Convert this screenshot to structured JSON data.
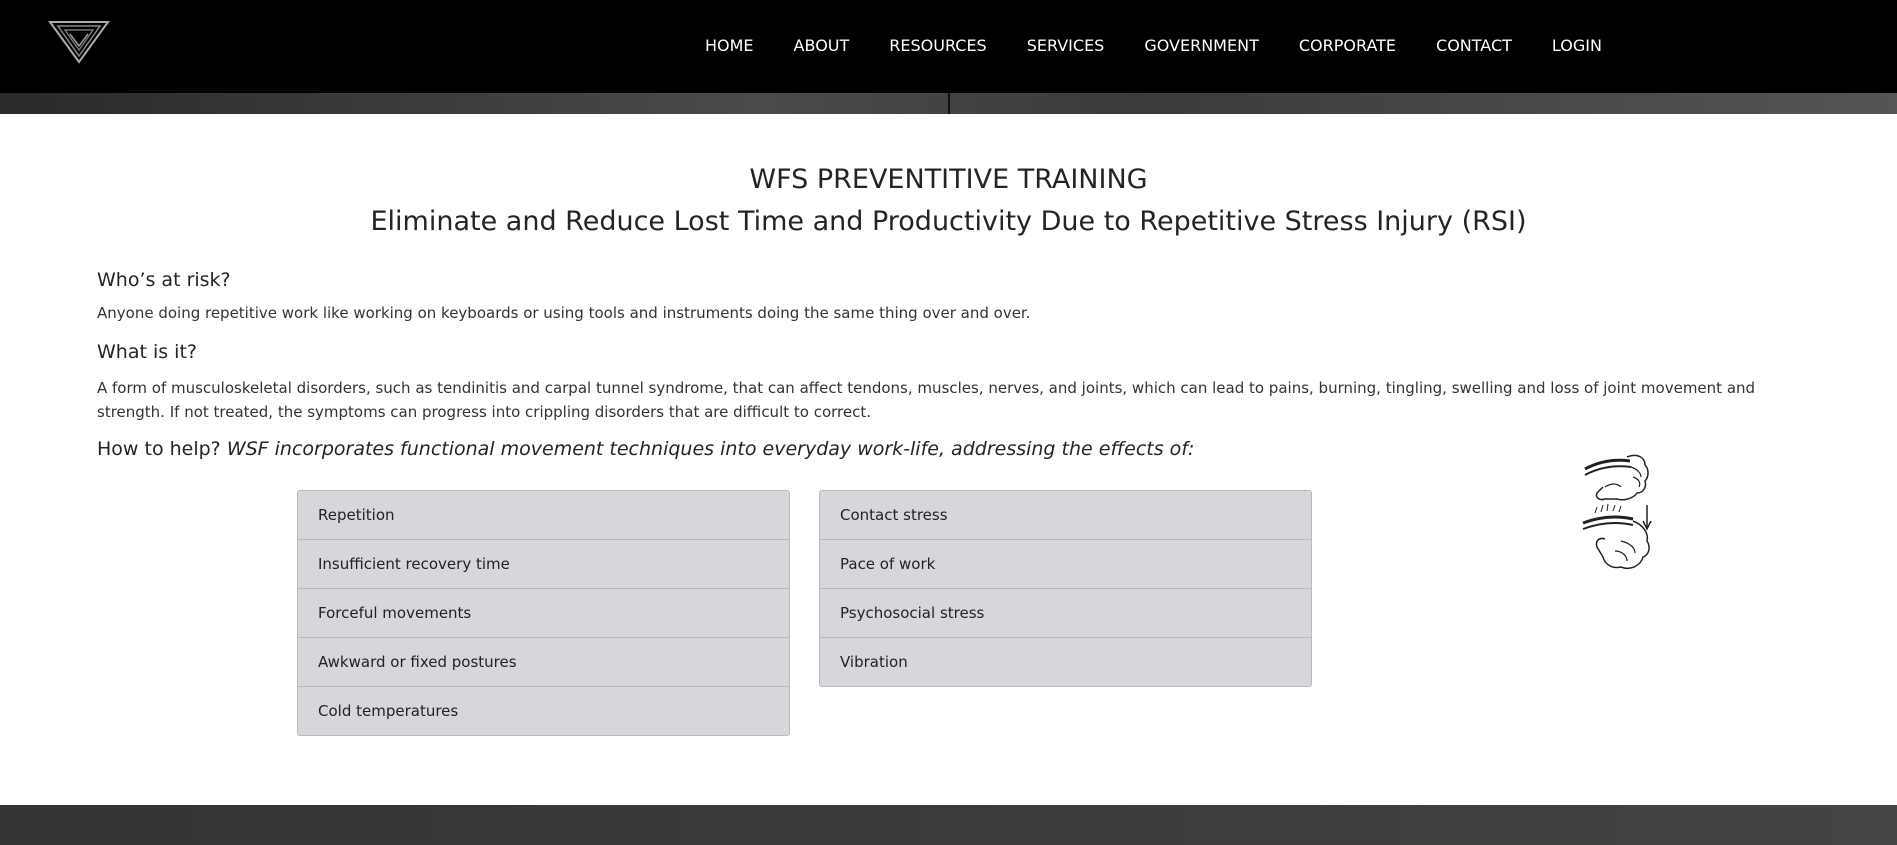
{
  "nav": {
    "items": [
      {
        "label": "HOME"
      },
      {
        "label": "ABOUT"
      },
      {
        "label": "RESOURCES"
      },
      {
        "label": "SERVICES"
      },
      {
        "label": "GOVERNMENT"
      },
      {
        "label": "CORPORATE"
      },
      {
        "label": "CONTACT"
      },
      {
        "label": "LOGIN"
      }
    ]
  },
  "logo": {
    "icon": "wfs-logo-icon"
  },
  "main": {
    "title": "WFS PREVENTITIVE TRAINING",
    "subtitle": "Eliminate and Reduce Lost Time and Productivity Due to Repetitive Stress Injury (RSI)",
    "risk_heading": "Who’s at risk?",
    "risk_text": "Anyone doing repetitive work like working on keyboards or using tools and instruments doing the same thing over and over.",
    "what_heading": "What is it?",
    "what_text": "A form of musculoskeletal disorders, such as tendinitis and carpal tunnel syndrome, that can affect tendons, muscles, nerves, and joints, which can lead to pains, burning, tingling, swelling and loss of joint movement and strength. If not treated, the symptoms can progress into crippling disorders that are difficult to correct.",
    "help_lead": "How to help?",
    "help_desc": "WSF incorporates functional movement techniques into everyday work-life, addressing the effects of:",
    "left_list": [
      "Repetition",
      "Insufficient recovery time",
      "Forceful movements",
      "Awkward or fixed postures",
      "Cold temperatures"
    ],
    "right_list": [
      "Contact stress",
      "Pace of work",
      "Psychosocial stress",
      "Vibration"
    ]
  },
  "illustration": {
    "icon": "wrist-stress-icon"
  }
}
